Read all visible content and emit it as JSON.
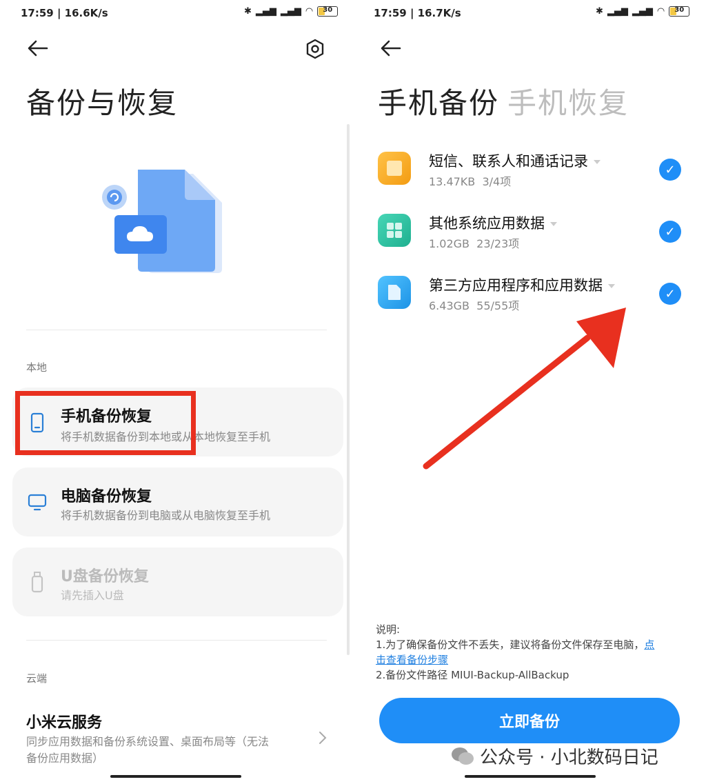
{
  "left": {
    "status": {
      "time_speed": "17:59 | 16.6K/s",
      "battery": "30"
    },
    "title": "备份与恢复",
    "section_local": "本地",
    "options": [
      {
        "title": "手机备份恢复",
        "subtitle": "将手机数据备份到本地或从本地恢复至手机"
      },
      {
        "title": "电脑备份恢复",
        "subtitle": "将手机数据备份到电脑或从电脑恢复至手机"
      },
      {
        "title": "U盘备份恢复",
        "subtitle": "请先插入U盘"
      }
    ],
    "section_cloud": "云端",
    "cloud": {
      "title": "小米云服务",
      "subtitle_line1": "同步应用数据和备份系统设置、桌面布局等（无法",
      "subtitle_line2": "备份应用数据）"
    },
    "icons": {
      "back": "back-arrow-icon",
      "settings": "settings-icon"
    }
  },
  "right": {
    "status": {
      "time_speed": "17:59 | 16.7K/s",
      "battery": "30"
    },
    "tab_active": "手机备份",
    "tab_inactive": "手机恢复",
    "items": [
      {
        "title": "短信、联系人和通话记录",
        "size": "13.47KB",
        "count": "3/4项",
        "icon_color": "#f5a623"
      },
      {
        "title": "其他系统应用数据",
        "size": "1.02GB",
        "count": "23/23项",
        "icon_color": "#2ec4a5"
      },
      {
        "title": "第三方应用程序和应用数据",
        "size": "6.43GB",
        "count": "55/55项",
        "icon_color": "#2aa6f0"
      }
    ],
    "notes": {
      "heading": "说明:",
      "line1": "1.为了确保备份文件不丢失，建议将备份文件保存至电脑，",
      "link_part1": "点",
      "link_part2": "击查看备份步骤",
      "line2": "2.备份文件路径 MIUI-Backup-AllBackup"
    },
    "button": "立即备份"
  },
  "watermark": "公众号 · 小北数码日记",
  "colors": {
    "accent": "#1f8ef7",
    "highlight": "#e8301f"
  }
}
